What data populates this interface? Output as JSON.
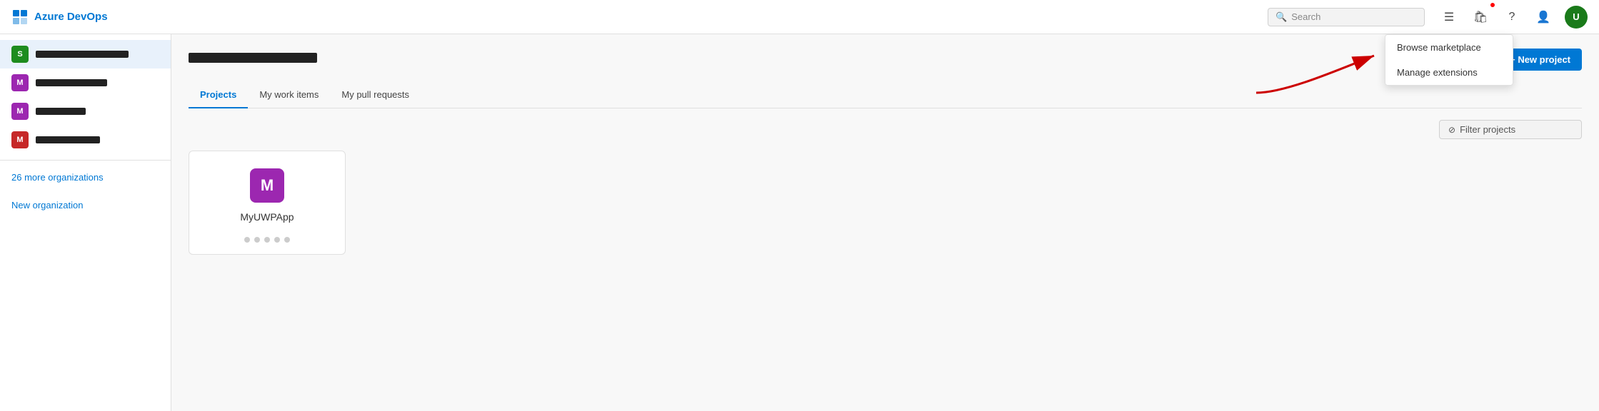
{
  "header": {
    "brand_name": "Azure DevOps",
    "search_placeholder": "Search"
  },
  "sidebar": {
    "orgs": [
      {
        "id": "org-1",
        "letter": "S",
        "color": "#1e8c1e",
        "redacted_width": 130
      },
      {
        "id": "org-2",
        "letter": "M",
        "color": "#9c27b0",
        "redacted_width": 100
      },
      {
        "id": "org-3",
        "letter": "M",
        "color": "#9c27b0",
        "redacted_width": 70
      },
      {
        "id": "org-4",
        "letter": "M",
        "color": "#c62828",
        "redacted_width": 90
      }
    ],
    "more_orgs_label": "26 more organizations",
    "new_org_label": "New organization"
  },
  "main": {
    "page_title_redacted_width": 180,
    "new_project_label": "+ New project",
    "tabs": [
      {
        "id": "projects",
        "label": "Projects",
        "active": true
      },
      {
        "id": "work-items",
        "label": "My work items",
        "active": false
      },
      {
        "id": "pull-requests",
        "label": "My pull requests",
        "active": false
      }
    ],
    "filter_placeholder": "Filter projects",
    "projects": [
      {
        "id": "myuwpapp",
        "letter": "M",
        "name": "MyUWPApp",
        "color": "#9c27b0"
      }
    ],
    "card_dots": [
      "",
      "",
      "",
      "",
      ""
    ]
  },
  "dropdown": {
    "items": [
      {
        "id": "browse-marketplace",
        "label": "Browse marketplace"
      },
      {
        "id": "manage-extensions",
        "label": "Manage extensions"
      }
    ]
  },
  "icons": {
    "search": "🔍",
    "filter": "⊘",
    "settings": "☰",
    "bag": "🛍",
    "help": "?",
    "user": "👤",
    "plus": "+"
  }
}
